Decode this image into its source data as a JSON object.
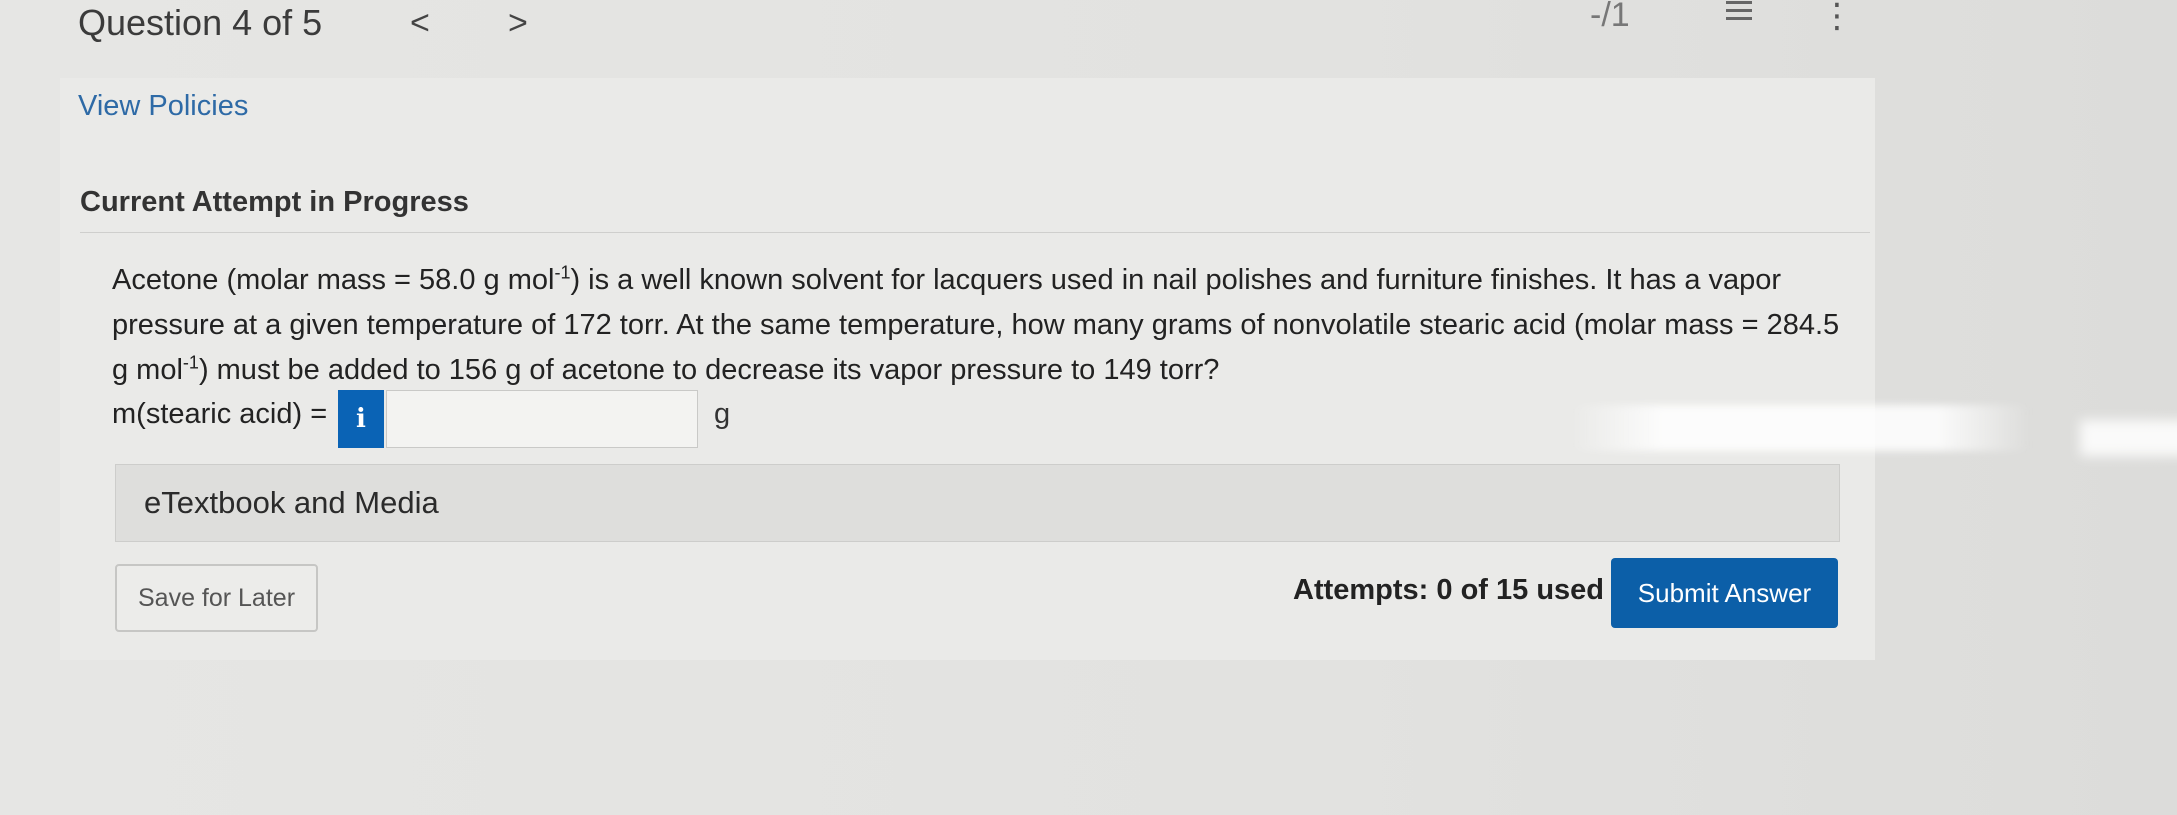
{
  "header": {
    "question_counter": "Question 4 of 5",
    "prev_glyph": "<",
    "next_glyph": ">",
    "score_text": "-/1",
    "list_icon": "list-icon",
    "more_icon": "more-vertical-icon"
  },
  "view_policies": "View Policies",
  "attempt_heading": "Current Attempt in Progress",
  "question": {
    "seg1": "Acetone (molar mass = 58.0 g mol",
    "sup1": "-1",
    "seg2": ") is a well known solvent for lacquers used in nail polishes and furniture finishes. It has a vapor pressure at a given temperature of 172 torr. At the same temperature, how many grams of nonvolatile stearic acid (molar mass = 284.5 g mol",
    "sup2": "-1",
    "seg3": ") must be added to 156 g of acetone to decrease its vapor pressure to 149 torr?"
  },
  "answer": {
    "label": "m(stearic acid) =",
    "info_glyph": "i",
    "value": "",
    "unit": "g"
  },
  "etextbook": "eTextbook and Media",
  "footer": {
    "save_label": "Save for Later",
    "attempts_text": "Attempts: 0 of 15 used",
    "submit_label": "Submit Answer"
  },
  "colors": {
    "link": "#2e6aa6",
    "primary": "#0c5fa8",
    "info": "#0a63b5"
  }
}
